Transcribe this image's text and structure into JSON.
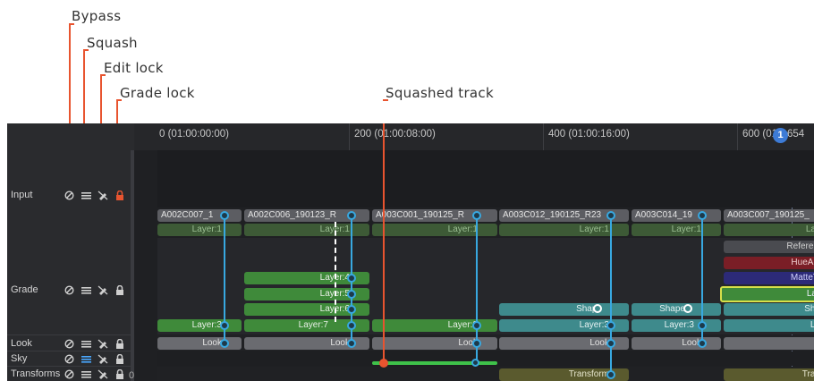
{
  "callouts": {
    "bypass": "Bypass",
    "squash": "Squash",
    "edit_lock": "Edit lock",
    "grade_lock": "Grade lock",
    "squashed_track": "Squashed track"
  },
  "ruler": {
    "ticks": [
      "0 (01:00:00:00)",
      "200 (01:00:08:00)",
      "400 (01:00:16:00)",
      "600 (01"
    ],
    "playhead_badge": "1",
    "playhead_frame": "654"
  },
  "rows": [
    {
      "name": "Input",
      "icons": [
        "bypass-icon",
        "squash-icon",
        "edit-lock-icon",
        "grade-lock-icon"
      ]
    },
    {
      "name": "Grade",
      "icons": [
        "bypass-icon",
        "squash-icon",
        "edit-lock-icon",
        "grade-lock-icon"
      ]
    },
    {
      "name": "Look",
      "icons": [
        "bypass-icon",
        "squash-icon",
        "edit-lock-icon",
        "grade-lock-icon"
      ]
    },
    {
      "name": "Sky",
      "icons": [
        "bypass-icon",
        "squash-icon",
        "edit-lock-icon",
        "grade-lock-icon"
      ]
    },
    {
      "name": "Transforms",
      "icons": [
        "bypass-icon",
        "squash-icon",
        "edit-lock-icon",
        "grade-lock-icon"
      ],
      "suffix": "0"
    }
  ],
  "clips": [
    {
      "name": "A002C007_1",
      "layer": "Layer:1"
    },
    {
      "name": "A002C006_190123_R",
      "layer": "Layer:1"
    },
    {
      "name": "A003C001_190125_R",
      "layer": "Layer:1"
    },
    {
      "name": "A003C012_190125_R23",
      "layer": "Layer:1"
    },
    {
      "name": "A003C014_19",
      "layer": "Layer:1"
    },
    {
      "name": "A003C007_190125_",
      "layer": "Lay"
    }
  ],
  "grade_nodes": {
    "col1": [
      "Layer:3"
    ],
    "col2": [
      "Layer:4",
      "Layer:5",
      "Layer:6",
      "Layer:7"
    ],
    "col3": [
      "Layer:3"
    ],
    "col4": [
      "Shape",
      "Layer:3"
    ],
    "col5": [
      "Shape",
      "Layer:3"
    ],
    "col6": [
      "Referen",
      "HueAn",
      "MatteT",
      "La",
      "Sha",
      "La"
    ]
  },
  "look_labels": [
    "Look",
    "Look",
    "Look",
    "Look",
    "Look",
    "L"
  ],
  "transform_labels": [
    "Transform",
    "Tran"
  ],
  "colors": {
    "accent": "#e8542f",
    "port": "#38a8e0",
    "green_node": "#3f8a3a",
    "squashed": "#3fc24a"
  }
}
